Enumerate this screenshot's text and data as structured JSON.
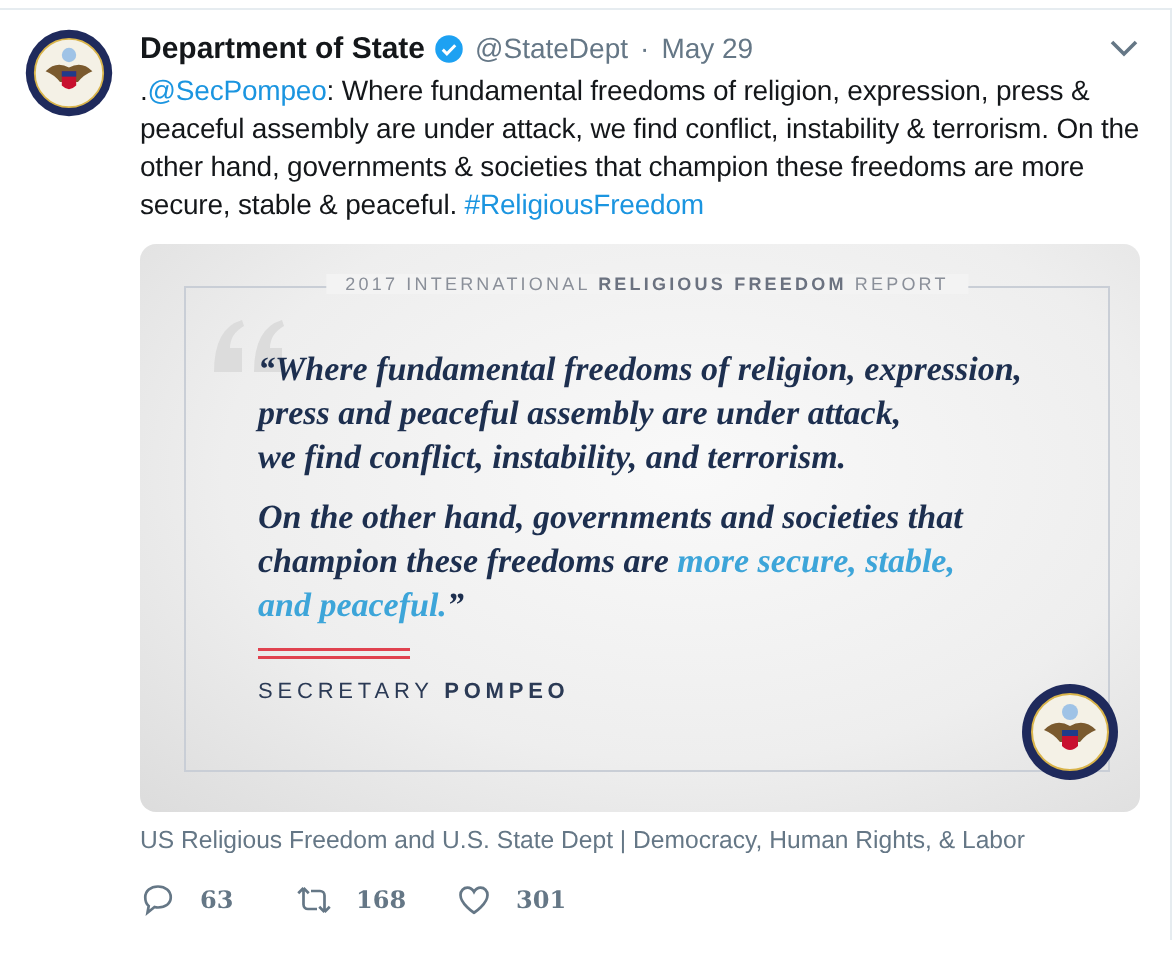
{
  "tweet": {
    "author": "Department of State",
    "verified": true,
    "handle": "@StateDept",
    "separator": "·",
    "date": "May 29",
    "text": [
      {
        "kind": "text",
        "text": "."
      },
      {
        "kind": "link",
        "text": "@SecPompeo"
      },
      {
        "kind": "text",
        "text": ": Where fundamental freedoms of religion, expression, press & peaceful assembly are under attack, we find conflict, instability & terrorism. On the other hand, governments & societies that champion these freedoms are more secure, stable & peaceful. "
      },
      {
        "kind": "link",
        "text": "#ReligiousFreedom"
      }
    ],
    "card": {
      "header": "2017 INTERNATIONAL **RELIGIOUS FREEDOM** REPORT",
      "paragraphs": [
        [
          [
            {
              "text": "“Where fundamental freedoms of religion, expression,",
              "highlight": false
            }
          ],
          [
            {
              "text": "press and peaceful assembly are under attack,",
              "highlight": false
            }
          ],
          [
            {
              "text": "we find conflict, instability, and terrorism.",
              "highlight": false
            }
          ]
        ],
        [
          [
            {
              "text": "On the other hand, governments and societies that",
              "highlight": false
            }
          ],
          [
            {
              "text": "champion these freedoms are ",
              "highlight": false
            },
            {
              "text": "more secure, stable,",
              "highlight": true
            }
          ],
          [
            {
              "text": "and peaceful.",
              "highlight": true
            },
            {
              "text": "”",
              "highlight": false
            }
          ]
        ]
      ],
      "signature": "SECRETARY **POMPEO**"
    },
    "caption": "US Religious Freedom and U.S. State Dept | Democracy, Human Rights, & Labor",
    "actions": [
      {
        "kind": "reply",
        "count": "63"
      },
      {
        "kind": "retweet",
        "count": "168"
      },
      {
        "kind": "like",
        "count": "301"
      }
    ]
  }
}
